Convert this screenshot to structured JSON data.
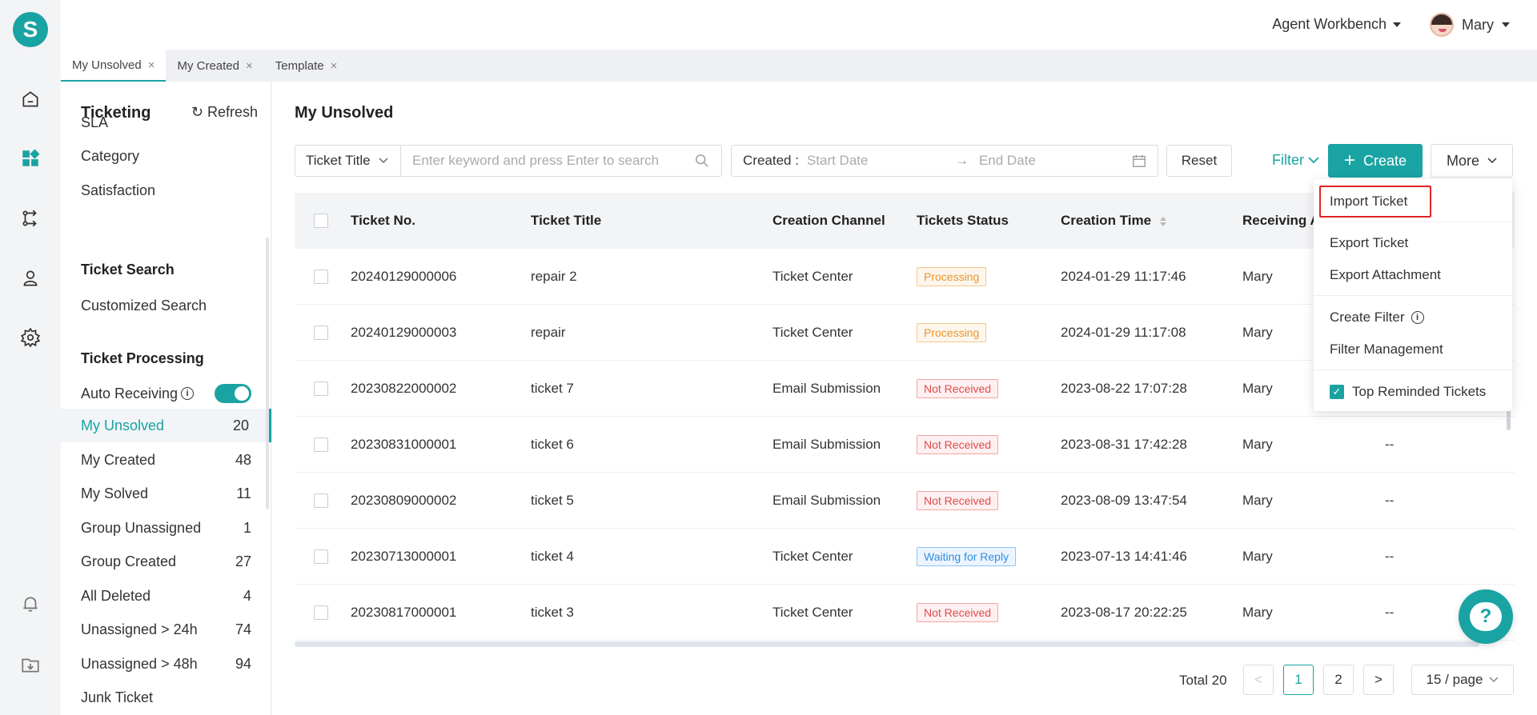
{
  "app": {
    "logo_letter": "S"
  },
  "header": {
    "workbench_label": "Agent Workbench",
    "user_name": "Mary"
  },
  "tabs": [
    {
      "label": "My Unsolved",
      "close": "×"
    },
    {
      "label": "My Created",
      "close": "×"
    },
    {
      "label": "Template",
      "close": "×"
    }
  ],
  "sidebar": {
    "title": "Ticketing",
    "refresh_label": "Refresh",
    "top_items": [
      "SLA",
      "Category",
      "Satisfaction"
    ],
    "search_section": "Ticket Search",
    "search_items": [
      "Customized Search"
    ],
    "processing_section": "Ticket Processing",
    "auto_receiving_label": "Auto Receiving",
    "auto_receiving_on": true,
    "queues": [
      {
        "label": "My Unsolved",
        "count": "20",
        "active": true
      },
      {
        "label": "My Created",
        "count": "48"
      },
      {
        "label": "My Solved",
        "count": "11"
      },
      {
        "label": "Group Unassigned",
        "count": "1"
      },
      {
        "label": "Group Created",
        "count": "27"
      },
      {
        "label": "All Deleted",
        "count": "4"
      },
      {
        "label": "Unassigned > 24h",
        "count": "74"
      },
      {
        "label": "Unassigned > 48h",
        "count": "94"
      },
      {
        "label": "Junk Ticket",
        "count": ""
      }
    ]
  },
  "main": {
    "title": "My Unsolved",
    "filter_field": "Ticket Title",
    "search_placeholder": "Enter keyword and press Enter to search",
    "created_label": "Created :",
    "start_placeholder": "Start Date",
    "range_arrow": "→",
    "end_placeholder": "End Date",
    "reset_label": "Reset",
    "filter_label": "Filter",
    "create_label": "Create",
    "more_label": "More"
  },
  "table": {
    "columns": [
      "Ticket No.",
      "Ticket Title",
      "Creation Channel",
      "Tickets Status",
      "Creation Time",
      "Receiving A"
    ],
    "rows": [
      {
        "no": "20240129000006",
        "title": "repair 2",
        "channel": "Ticket Center",
        "status": "Processing",
        "time": "2024-01-29 11:17:46",
        "receiver": "Mary",
        "extra": ""
      },
      {
        "no": "20240129000003",
        "title": "repair",
        "channel": "Ticket Center",
        "status": "Processing",
        "time": "2024-01-29 11:17:08",
        "receiver": "Mary",
        "extra": ""
      },
      {
        "no": "20230822000002",
        "title": "ticket 7",
        "channel": "Email Submission",
        "status": "Not Received",
        "time": "2023-08-22 17:07:28",
        "receiver": "Mary",
        "extra": ""
      },
      {
        "no": "20230831000001",
        "title": "ticket 6",
        "channel": "Email Submission",
        "status": "Not Received",
        "time": "2023-08-31 17:42:28",
        "receiver": "Mary",
        "extra": "--"
      },
      {
        "no": "20230809000002",
        "title": "ticket 5",
        "channel": "Email Submission",
        "status": "Not Received",
        "time": "2023-08-09 13:47:54",
        "receiver": "Mary",
        "extra": "--"
      },
      {
        "no": "20230713000001",
        "title": "ticket 4",
        "channel": "Ticket Center",
        "status": "Waiting for Reply",
        "time": "2023-07-13 14:41:46",
        "receiver": "Mary",
        "extra": "--"
      },
      {
        "no": "20230817000001",
        "title": "ticket 3",
        "channel": "Ticket Center",
        "status": "Not Received",
        "time": "2023-08-17 20:22:25",
        "receiver": "Mary",
        "extra": "--"
      }
    ]
  },
  "status_colors": {
    "Processing": {
      "text": "#e8962e",
      "bg": "#fdf6ec",
      "border": "#f3c98a"
    },
    "Not Received": {
      "text": "#e04b4b",
      "bg": "#fef0f0",
      "border": "#f3a3a3"
    },
    "Waiting for Reply": {
      "text": "#2f8ee0",
      "bg": "#ecf5ff",
      "border": "#8fc3f0"
    }
  },
  "more_menu": {
    "items": [
      "Import Ticket",
      "Export Ticket",
      "Export Attachment",
      "Create Filter",
      "Filter Management"
    ],
    "top_reminded_label": "Top Reminded Tickets",
    "top_reminded_checked": true
  },
  "pagination": {
    "total_label": "Total 20",
    "pages": [
      "1",
      "2"
    ],
    "current_page": "1",
    "page_size": "15 / page",
    "prev": "<",
    "next": ">"
  },
  "help": {
    "label": "?"
  },
  "colors": {
    "accent": "#1aa3a3",
    "highlight": "#e02424"
  }
}
